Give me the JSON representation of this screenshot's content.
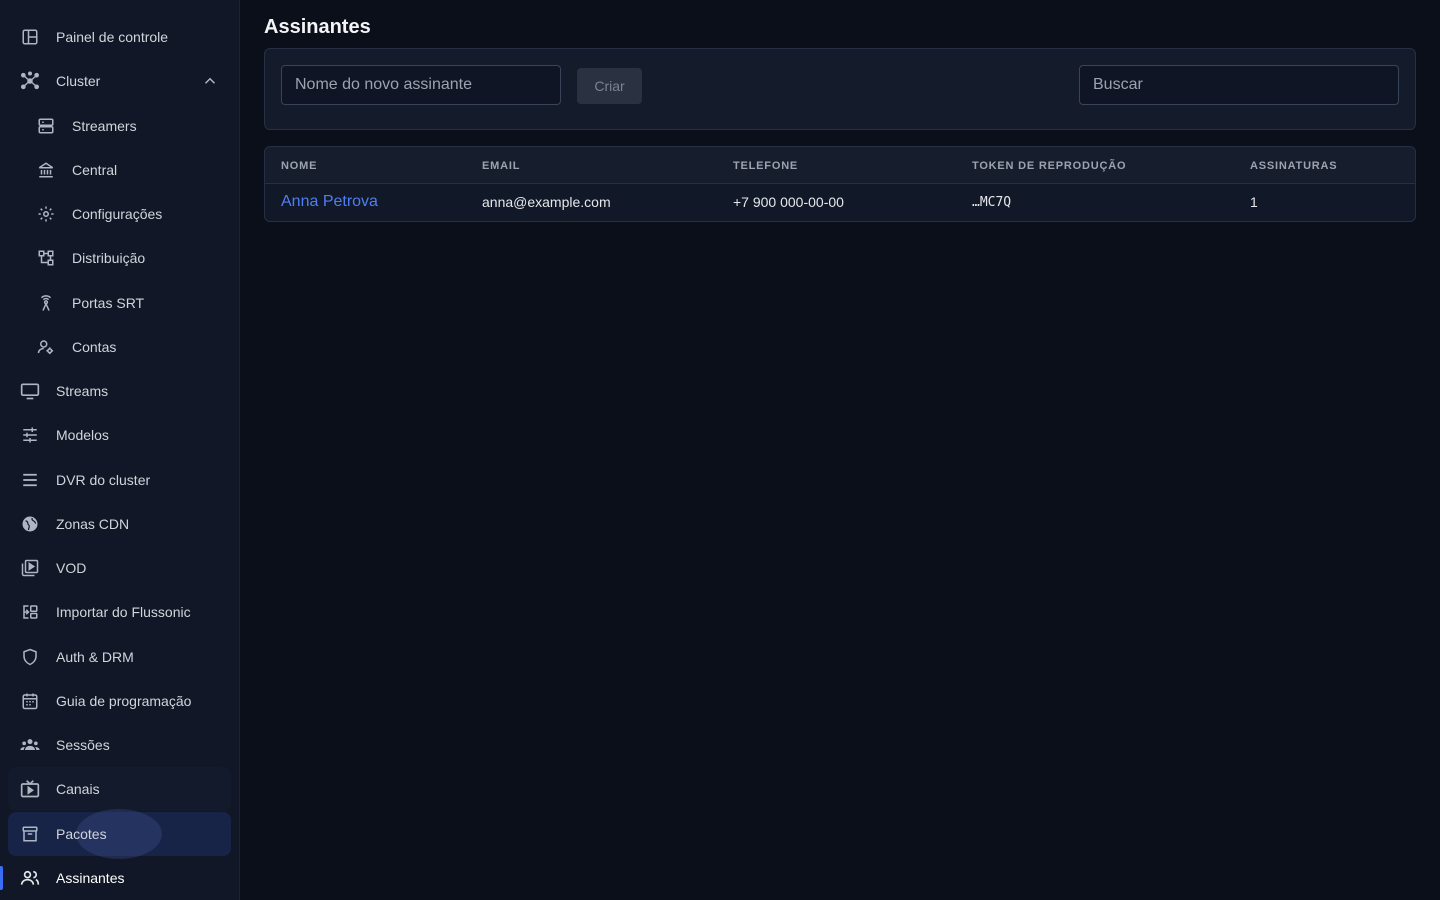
{
  "sidebar": {
    "items": [
      {
        "label": "Painel de controle",
        "icon": "dashboard-icon"
      },
      {
        "label": "Cluster",
        "icon": "cluster-icon"
      },
      {
        "label": "Streamers",
        "icon": "server-icon"
      },
      {
        "label": "Central",
        "icon": "bank-icon"
      },
      {
        "label": "Configurações",
        "icon": "gear-icon"
      },
      {
        "label": "Distribuição",
        "icon": "distribution-icon"
      },
      {
        "label": "Portas SRT",
        "icon": "antenna-icon"
      },
      {
        "label": "Contas",
        "icon": "account-settings-icon"
      },
      {
        "label": "Streams",
        "icon": "monitor-icon"
      },
      {
        "label": "Modelos",
        "icon": "sliders-icon"
      },
      {
        "label": "DVR do cluster",
        "icon": "storage-icon"
      },
      {
        "label": "Zonas CDN",
        "icon": "globe-icon"
      },
      {
        "label": "VOD",
        "icon": "video-library-icon"
      },
      {
        "label": "Importar do Flussonic",
        "icon": "import-icon"
      },
      {
        "label": "Auth & DRM",
        "icon": "shield-icon"
      },
      {
        "label": "Guia de programação",
        "icon": "calendar-icon"
      },
      {
        "label": "Sessões",
        "icon": "group-icon"
      },
      {
        "label": "Canais",
        "icon": "tv-play-icon"
      },
      {
        "label": "Pacotes",
        "icon": "archive-box-icon"
      },
      {
        "label": "Assinantes",
        "icon": "users-icon"
      }
    ],
    "active": "Assinantes"
  },
  "page": {
    "title": "Assinantes"
  },
  "toolbar": {
    "new_name_placeholder": "Nome do novo assinante",
    "create_label": "Criar",
    "search_placeholder": "Buscar"
  },
  "table": {
    "headers": [
      "NOME",
      "EMAIL",
      "TELEFONE",
      "TOKEN DE REPRODUÇÃO",
      "ASSINATURAS"
    ],
    "rows": [
      {
        "name": "Anna Petrova",
        "email": "anna@example.com",
        "phone": "+7 900 000-00-00",
        "token": "…MC7Q",
        "subscriptions": "1"
      }
    ]
  },
  "colors": {
    "accent": "#3b6cf6",
    "link": "#4f7df3",
    "background": "#0b0f1a",
    "sidebar": "#111726"
  }
}
